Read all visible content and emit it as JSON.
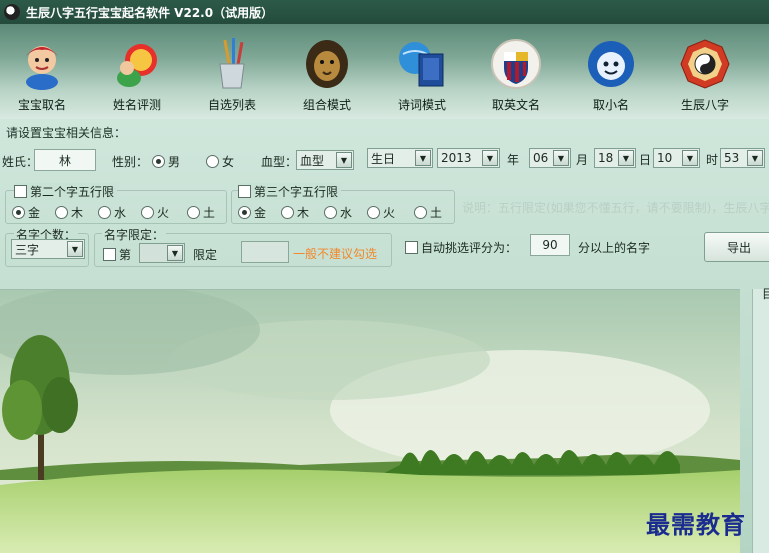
{
  "window": {
    "title": "生辰八字五行宝宝起名软件 V22.0（试用版）"
  },
  "toolbar": {
    "items": [
      {
        "label": "宝宝取名",
        "icon": "baby-mascot-icon"
      },
      {
        "label": "姓名评测",
        "icon": "fortune-character-icon"
      },
      {
        "label": "自选列表",
        "icon": "pencil-cup-icon"
      },
      {
        "label": "组合模式",
        "icon": "lion-head-icon"
      },
      {
        "label": "诗词模式",
        "icon": "book-globe-icon"
      },
      {
        "label": "取英文名",
        "icon": "barcelona-crest-icon"
      },
      {
        "label": "取小名",
        "icon": "blue-mascot-icon"
      },
      {
        "label": "生辰八字",
        "icon": "bagua-icon"
      }
    ]
  },
  "form": {
    "section_title": "请设置宝宝相关信息：",
    "surname_label": "姓氏：",
    "surname_value": "林",
    "gender_label": "性别：",
    "gender_male": "男",
    "gender_female": "女",
    "blood_label": "血型：",
    "blood_value": "血型",
    "birth_value": "生日",
    "year_value": "2013",
    "year_label": "年",
    "month_value": "06",
    "month_label": "月",
    "day_value": "18",
    "day_label": "日",
    "hour_value": "10",
    "hour_label": "时",
    "minute_value": "53"
  },
  "second_char": {
    "label": "第二个字五行限",
    "options": [
      "金",
      "木",
      "水",
      "火",
      "土"
    ],
    "selected": "金"
  },
  "third_char": {
    "label": "第三个字五行限",
    "options": [
      "金",
      "木",
      "水",
      "火",
      "土"
    ],
    "selected": "金"
  },
  "note": "说明：五行限定(如果您不懂五行，请不要限制)，生辰八字",
  "name_count": {
    "label": "名字个数：",
    "value": "三字"
  },
  "name_limit": {
    "label": "名字限定：",
    "check_label": "第",
    "limit_label": "限定",
    "hint": "一般不建议勾选"
  },
  "auto_select": {
    "label": "自动挑选评分为：",
    "value": "90",
    "suffix": "分以上的名字"
  },
  "export_button": "导出",
  "right_panel_char": "目",
  "watermark": "最需教育",
  "colors": {
    "titlebar": "#244b3c",
    "watermark": "#1a2c8f",
    "hint": "#f0882a"
  }
}
